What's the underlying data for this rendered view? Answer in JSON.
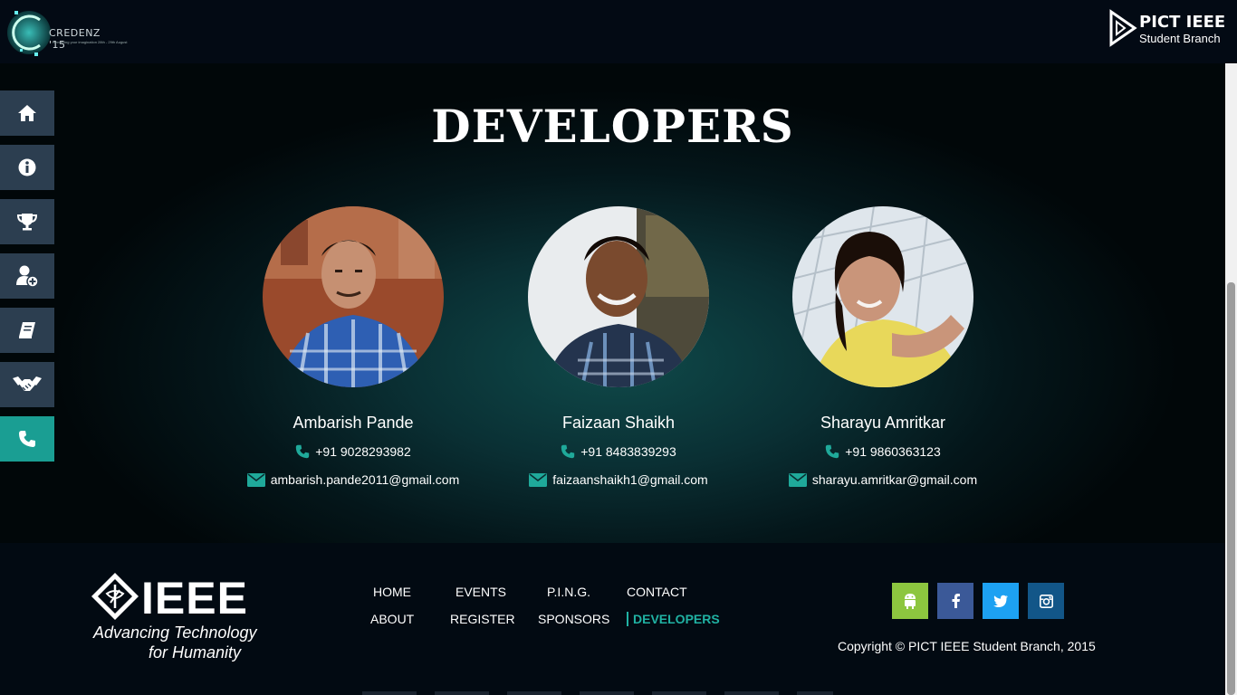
{
  "header": {
    "left_logo": {
      "word": "CREDENZ '15",
      "tagline": "Rendering your imagination 28th - 29th August"
    },
    "right_logo": {
      "line1": "PICT IEEE",
      "line2": "Student Branch"
    }
  },
  "sidebar": {
    "items": [
      {
        "icon": "home-icon",
        "active": false
      },
      {
        "icon": "info-icon",
        "active": false
      },
      {
        "icon": "trophy-icon",
        "active": false
      },
      {
        "icon": "user-plus-icon",
        "active": false
      },
      {
        "icon": "book-icon",
        "active": false
      },
      {
        "icon": "handshake-icon",
        "active": false
      },
      {
        "icon": "phone-icon",
        "active": true
      }
    ]
  },
  "main": {
    "title": "DEVELOPERS",
    "developers": [
      {
        "name": "Ambarish Pande",
        "phone": "+91 9028293982",
        "email": "ambarish.pande2011@gmail.com"
      },
      {
        "name": "Faizaan Shaikh",
        "phone": "+91 8483839293",
        "email": "faizaanshaikh1@gmail.com"
      },
      {
        "name": "Sharayu Amritkar",
        "phone": "+91 9860363123",
        "email": "sharayu.amritkar@gmail.com"
      }
    ]
  },
  "footer": {
    "ieee_logo": {
      "word": "IEEE",
      "tag1": "Advancing Technology",
      "tag2": "for Humanity"
    },
    "nav": {
      "home": "HOME",
      "events": "EVENTS",
      "ping": "P.I.N.G.",
      "contact": "CONTACT",
      "about": "ABOUT",
      "register": "REGISTER",
      "sponsors": "SPONSORS",
      "developers": "DEVELOPERS"
    },
    "social": [
      {
        "icon": "android-icon",
        "color": "#8dc63f"
      },
      {
        "icon": "facebook-icon",
        "color": "#3b5998"
      },
      {
        "icon": "twitter-icon",
        "color": "#1da1f2"
      },
      {
        "icon": "instagram-icon",
        "color": "#125688"
      }
    ],
    "copyright": "Copyright © PICT IEEE Student Branch, 2015"
  },
  "colors": {
    "accent": "#1a9e93",
    "sidebar_bg": "#2c3e50"
  }
}
